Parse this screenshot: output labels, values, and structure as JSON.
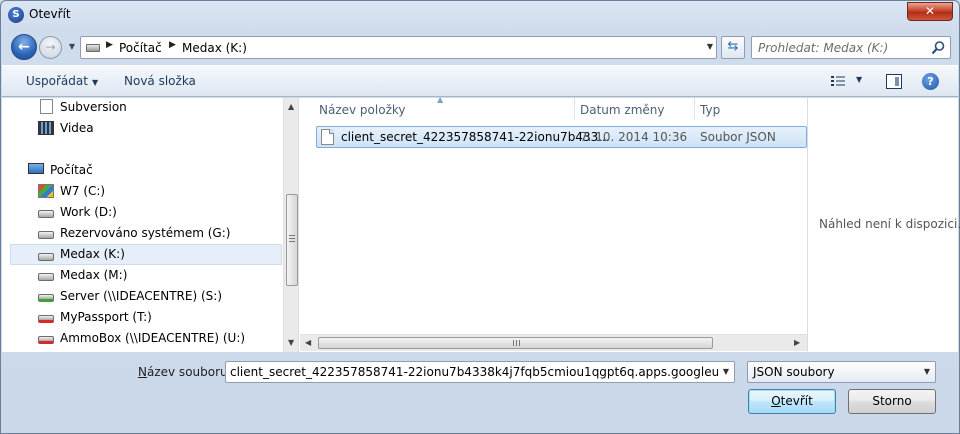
{
  "window": {
    "title": "Otevřít",
    "close_label": "✕"
  },
  "address": {
    "segments": [
      "Počítač",
      "Medax (K:)"
    ]
  },
  "search": {
    "placeholder": "Prohledat: Medax (K:)"
  },
  "toolbar": {
    "organize_label": "Uspořádat",
    "new_folder_label": "Nová složka"
  },
  "nav": {
    "items": [
      {
        "label": "Subversion",
        "icon": "subversion-icon"
      },
      {
        "label": "Videa",
        "icon": "video-icon"
      },
      {
        "label": "Počítač",
        "icon": "computer-icon"
      },
      {
        "label": "W7 (C:)",
        "icon": "windows-drive-icon"
      },
      {
        "label": "Work (D:)",
        "icon": "drive-icon"
      },
      {
        "label": "Rezervováno systémem (G:)",
        "icon": "drive-icon"
      },
      {
        "label": "Medax (K:)",
        "icon": "drive-icon",
        "selected": true
      },
      {
        "label": "Medax (M:)",
        "icon": "drive-icon"
      },
      {
        "label": "Server (\\\\IDEACENTRE) (S:)",
        "icon": "network-drive-icon"
      },
      {
        "label": "MyPassport (T:)",
        "icon": "disconnected-network-drive-icon"
      },
      {
        "label": "AmmoBox (\\\\IDEACENTRE) (U:)",
        "icon": "disconnected-network-drive-icon"
      }
    ]
  },
  "file_list": {
    "columns": [
      "Název položky",
      "Datum změny",
      "Typ"
    ],
    "rows": [
      {
        "name": "client_secret_422357858741-22ionu7b433...",
        "date": "7. 10. 2014 10:36",
        "type": "Soubor JSON",
        "selected": true
      }
    ]
  },
  "preview": {
    "text": "Náhled není k dispozici."
  },
  "bottom": {
    "filename_label_prefix": "N",
    "filename_label_rest": "ázev souboru:",
    "filename_value": "client_secret_422357858741-22ionu7b4338k4j7fqb5cmiou1qgpt6q.apps.googleusercontent.com",
    "file_type": "JSON soubory",
    "open_label_prefix": "O",
    "open_label_rest": "tevřít",
    "cancel_label": "Storno"
  },
  "colors": {
    "accent": "#2a65b8",
    "selection": "#cde2f7",
    "close": "#c7462e"
  }
}
